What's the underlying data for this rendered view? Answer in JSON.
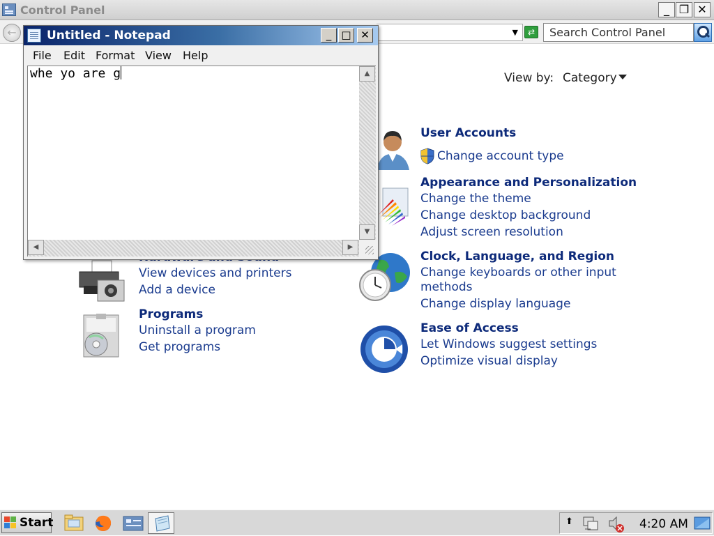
{
  "control_panel": {
    "title": "Control Panel",
    "search_placeholder": "Search Control Panel",
    "view_by_label": "View by:",
    "view_by_value": "Category",
    "categories": [
      {
        "title": "User Accounts",
        "links": [
          "Change account type"
        ]
      },
      {
        "title": "Appearance and Personalization",
        "links": [
          "Change the theme",
          "Change desktop background",
          "Adjust screen resolution"
        ]
      },
      {
        "title": "Clock, Language, and Region",
        "links": [
          "Change keyboards or other input",
          "methods",
          "Change display language"
        ]
      },
      {
        "title": "Ease of Access",
        "links": [
          "Let Windows suggest settings",
          "Optimize visual display"
        ]
      },
      {
        "title": "Hardware and Sound",
        "links": [
          "View devices and printers",
          "Add a device"
        ]
      },
      {
        "title": "Programs",
        "links": [
          "Uninstall a program",
          "Get programs"
        ]
      }
    ]
  },
  "notepad": {
    "title": "Untitled - Notepad",
    "menu": [
      "File",
      "Edit",
      "Format",
      "View",
      "Help"
    ],
    "content": "whe yo are g"
  },
  "taskbar": {
    "start_label": "Start",
    "clock": "4:20 AM"
  },
  "colors": {
    "link": "#1a3b8e",
    "category_title": "#0d2a7a",
    "notepad_title_start": "#0a246a",
    "notepad_title_end": "#a6caf0"
  }
}
